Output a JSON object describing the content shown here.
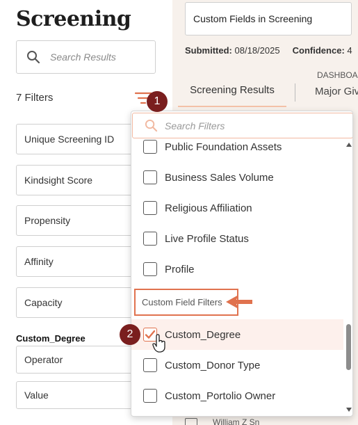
{
  "left": {
    "title": "Screening",
    "search": {
      "placeholder": "Search Results"
    },
    "filters_count": "7 Filters",
    "filter_fields": [
      "Unique Screening ID",
      "Kindsight Score",
      "Propensity",
      "Affinity",
      "Capacity"
    ],
    "custom_degree": {
      "label": "Custom_Degree",
      "operator": "Operator",
      "value": "Value"
    }
  },
  "header": {
    "name_value": "Custom Fields in Screening",
    "submitted_label": "Submitted:",
    "submitted_value": "08/18/2025",
    "confidence_label": "Confidence:",
    "confidence_value": "4",
    "tab_screening": "Screening Results",
    "dashboard_label": "DASHBOA",
    "tab_major": "Major Giv",
    "bottom_peek": "William Z Sn"
  },
  "dropdown": {
    "search_placeholder": "Search Filters",
    "options": [
      {
        "label": "Public Foundation Assets",
        "checked": false
      },
      {
        "label": "Business Sales Volume",
        "checked": false
      },
      {
        "label": "Religious Affiliation",
        "checked": false
      },
      {
        "label": "Live Profile Status",
        "checked": false
      },
      {
        "label": "Profile",
        "checked": false
      }
    ],
    "group_header": "Custom Field Filters",
    "custom_options": [
      {
        "label": "Custom_Degree",
        "checked": true
      },
      {
        "label": "Custom_Donor Type",
        "checked": false
      },
      {
        "label": "Custom_Portolio Owner",
        "checked": false
      }
    ]
  },
  "annotations": {
    "step1": "1",
    "step2": "2"
  },
  "colors": {
    "accent": "#e0724e",
    "badge": "#7a1e1e",
    "panel_bg": "#f7f1ec",
    "checked_row": "#fdf0ec"
  },
  "icons": [
    "search-icon",
    "filter-lines-icon",
    "checkmark-icon",
    "scroll-up-icon",
    "scroll-down-icon",
    "hand-cursor-icon",
    "arrow-left-icon"
  ]
}
